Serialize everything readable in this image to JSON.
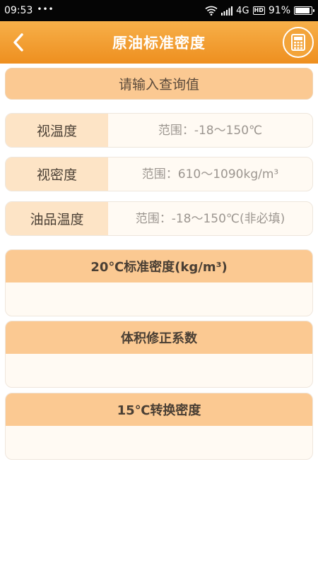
{
  "status_bar": {
    "time": "09:53",
    "notification_dots": "•••",
    "network_type": "4G",
    "hd_badge": "HD",
    "battery_percent": "91%",
    "battery_level": 0.91
  },
  "header": {
    "title": "原油标准密度",
    "back_icon": "chevron-left-icon",
    "calculator_icon": "calculator-icon"
  },
  "prompt": {
    "text": "请输入查询值"
  },
  "inputs": [
    {
      "label": "视温度",
      "value": "",
      "placeholder": "范围：-18～150℃"
    },
    {
      "label": "视密度",
      "value": "",
      "placeholder": "范围：610～1090kg/m³"
    },
    {
      "label": "油品温度",
      "value": "",
      "placeholder": "范围：-18～150℃(非必填)"
    }
  ],
  "results": [
    {
      "title": "20℃标准密度(kg/m³)",
      "value": ""
    },
    {
      "title": "体积修正系数",
      "value": ""
    },
    {
      "title": "15℃转换密度",
      "value": ""
    }
  ],
  "colors": {
    "header_gradient_top": "#f7b04a",
    "header_gradient_bottom": "#ee8f1f",
    "section_header": "#fbc992",
    "label_background": "#fde4c6"
  }
}
